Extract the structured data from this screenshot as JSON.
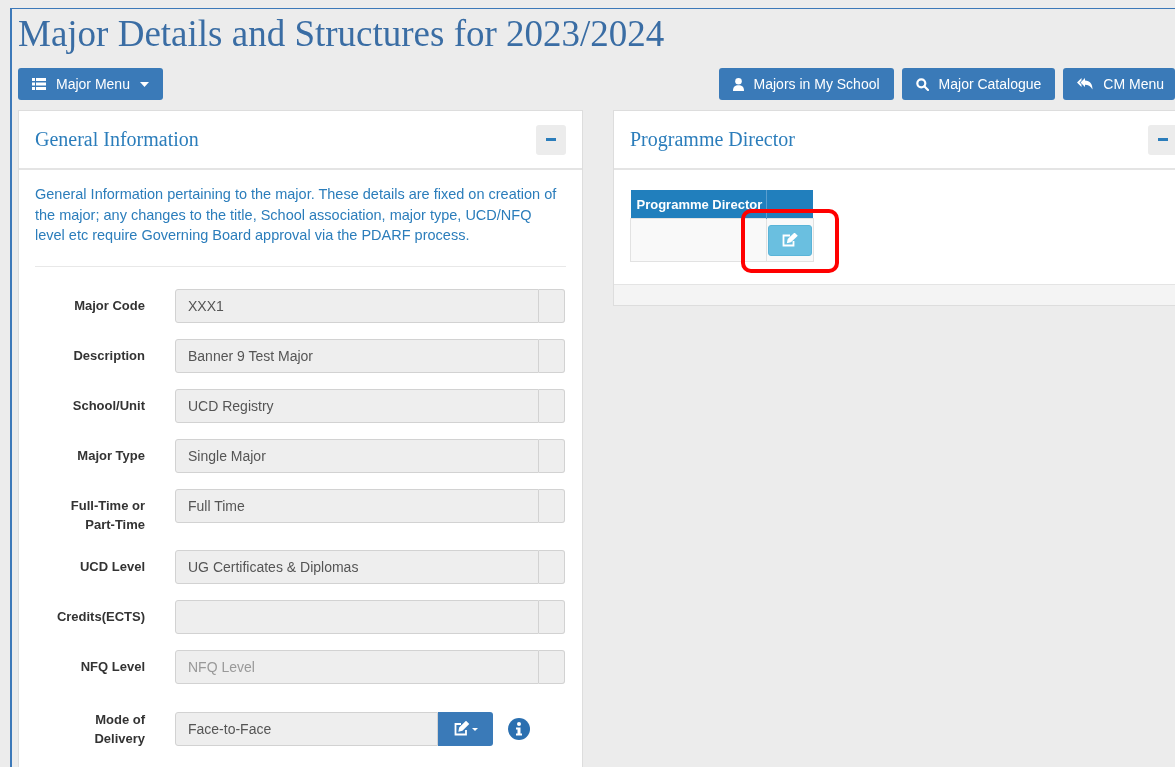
{
  "page_title": "Major Details and Structures for 2023/2024",
  "toolbar": {
    "menu_button": "Major Menu",
    "buttons": [
      {
        "label": "Majors in My School"
      },
      {
        "label": "Major Catalogue"
      },
      {
        "label": "CM Menu"
      }
    ]
  },
  "general_information": {
    "title": "General Information",
    "description": "General Information pertaining to the major. These details are fixed on creation of the major; any changes to the title, School association, major type, UCD/NFQ level etc require Governing Board approval via the PDARF process.",
    "fields": [
      {
        "kind": "readonly",
        "label": "Major Code",
        "value": "XXX1"
      },
      {
        "kind": "readonly",
        "label": "Description",
        "value": "Banner 9 Test Major"
      },
      {
        "kind": "readonly",
        "label": "School/Unit",
        "value": "UCD Registry"
      },
      {
        "kind": "readonly",
        "label": "Major Type",
        "value": "Single Major"
      },
      {
        "kind": "readonly",
        "label": "Full-Time or Part-Time",
        "value": "Full Time"
      },
      {
        "kind": "readonly",
        "label": "UCD Level",
        "value": "UG Certificates & Diplomas"
      },
      {
        "kind": "readonly",
        "label": "Credits(ECTS)"
      },
      {
        "kind": "readonly",
        "label": "NFQ Level",
        "placeholder": "NFQ Level"
      },
      {
        "kind": "editable",
        "label": "Mode of Delivery",
        "value": "Face-to-Face"
      }
    ]
  },
  "programme_director": {
    "title": "Programme Director",
    "table": {
      "columns": [
        "Programme Director"
      ],
      "rows": [
        {
          "highlighted": true
        }
      ]
    }
  }
}
